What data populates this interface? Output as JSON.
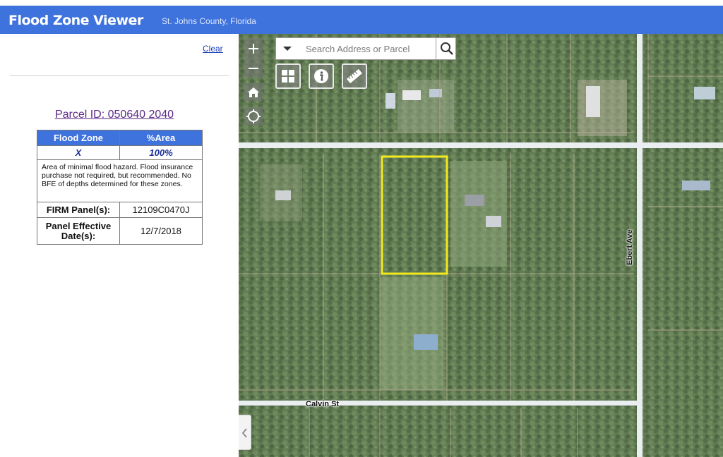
{
  "app": {
    "title": "Flood Zone Viewer",
    "subtitle": "St. Johns County, Florida"
  },
  "panel": {
    "clear_label": "Clear",
    "parcel_title": "Parcel ID: 050640 2040",
    "table": {
      "col_zone": "Flood Zone",
      "col_area": "%Area",
      "zone": "X",
      "area": "100%",
      "description": "Area of minimal flood hazard. Flood insurance purchase not required, but recommended. No BFE of depths determined for these zones.",
      "firm_label": "FIRM Panel(s):",
      "firm_value": "12109C0470J",
      "date_label": "Panel Effective Date(s):",
      "date_value": "12/7/2018"
    }
  },
  "map": {
    "search_placeholder": "Search Address or Parcel",
    "streets": {
      "ebert": "Ebert Ave",
      "calvin": "Calvin St"
    },
    "parcel_highlight_color": "#f2e600"
  },
  "icons": {
    "zoom_in": "plus-icon",
    "zoom_out": "minus-icon",
    "home": "home-icon",
    "locate": "locate-icon",
    "search": "search-icon",
    "dropdown": "caret-down-icon",
    "basemap": "grid-icon",
    "info": "info-icon",
    "measure": "ruler-icon",
    "collapse": "chevron-left-icon"
  },
  "colors": {
    "header": "#3e72dd",
    "table_header": "#3e72dd",
    "link": "#1a3fb8",
    "parcel_title": "#5b2a86"
  }
}
